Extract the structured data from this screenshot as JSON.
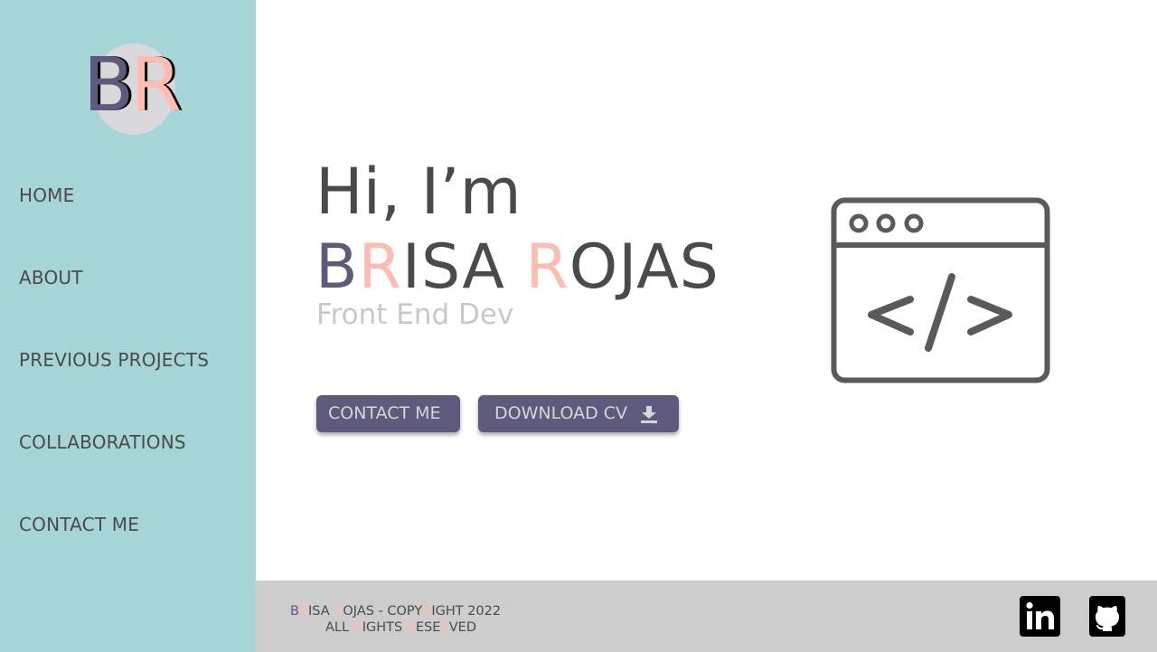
{
  "logo": {
    "letter_b": "B",
    "letter_r": "R"
  },
  "nav": {
    "items": [
      {
        "label": "HOME"
      },
      {
        "label": "ABOUT"
      },
      {
        "label": "PREVIOUS PROJECTS"
      },
      {
        "label": "COLLABORATIONS"
      },
      {
        "label": "CONTACT ME"
      }
    ]
  },
  "hero": {
    "greeting": "Hi, I’m",
    "name_b": "B",
    "name_r": "R",
    "name_isa": "ISA ",
    "name_r2": "R",
    "name_ojas": "OJAS",
    "subtitle": "Front End Dev"
  },
  "buttons": {
    "contact": "CONTACT ME",
    "download": "DOWNLOAD CV"
  },
  "footer": {
    "line1_parts": [
      "B",
      "R",
      "ISA ",
      "R",
      "OJAS - COPY",
      "R",
      "IGHT 2022"
    ],
    "line2_parts": [
      "ALL ",
      "R",
      "IGHTS ",
      "R",
      "ESE",
      "R",
      "VED"
    ]
  },
  "icons": {
    "download": "download-icon",
    "code_window": "code-window-icon",
    "linkedin": "linkedin-icon",
    "github": "github-icon"
  },
  "colors": {
    "sidebar": "#a5d5d7",
    "accent_purple": "#5d5a7d",
    "accent_pink": "#ffbcb0",
    "footer": "#cdcdcd",
    "text": "#4a4a4a"
  }
}
